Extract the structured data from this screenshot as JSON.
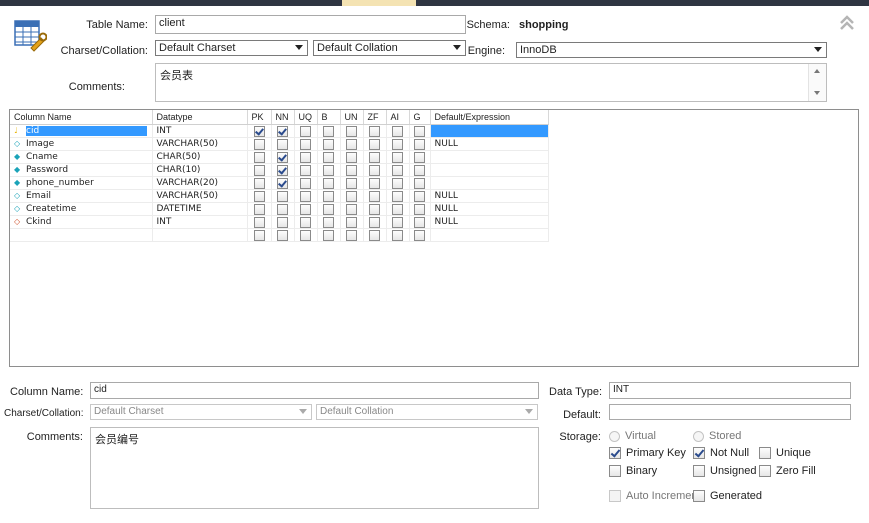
{
  "table": {
    "name_label": "Table Name:",
    "name_value": "client",
    "schema_label": "Schema:",
    "schema_value": "shopping",
    "charset_label": "Charset/Collation:",
    "charset_value": "Default Charset",
    "collation_value": "Default Collation",
    "engine_label": "Engine:",
    "engine_value": "InnoDB",
    "comments_label": "Comments:",
    "comments_value": "会员表"
  },
  "grid": {
    "headers": [
      "Column Name",
      "Datatype",
      "PK",
      "NN",
      "UQ",
      "B",
      "UN",
      "ZF",
      "AI",
      "G",
      "Default/Expression"
    ],
    "rows": [
      {
        "name": "cid",
        "type": "INT",
        "flags": [
          1,
          1,
          0,
          0,
          0,
          0,
          0,
          0
        ],
        "default": "",
        "icon": "key",
        "selected": true
      },
      {
        "name": "Image",
        "type": "VARCHAR(50)",
        "flags": [
          0,
          0,
          0,
          0,
          0,
          0,
          0,
          0
        ],
        "default": "NULL",
        "icon": "diamond-empty",
        "selected": false
      },
      {
        "name": "Cname",
        "type": "CHAR(50)",
        "flags": [
          0,
          1,
          0,
          0,
          0,
          0,
          0,
          0
        ],
        "default": "",
        "icon": "diamond-filled",
        "selected": false
      },
      {
        "name": "Password",
        "type": "CHAR(10)",
        "flags": [
          0,
          1,
          0,
          0,
          0,
          0,
          0,
          0
        ],
        "default": "",
        "icon": "diamond-filled",
        "selected": false
      },
      {
        "name": "phone_number",
        "type": "VARCHAR(20)",
        "flags": [
          0,
          1,
          0,
          0,
          0,
          0,
          0,
          0
        ],
        "default": "",
        "icon": "diamond-filled",
        "selected": false
      },
      {
        "name": "Email",
        "type": "VARCHAR(50)",
        "flags": [
          0,
          0,
          0,
          0,
          0,
          0,
          0,
          0
        ],
        "default": "NULL",
        "icon": "diamond-empty",
        "selected": false
      },
      {
        "name": "Createtime",
        "type": "DATETIME",
        "flags": [
          0,
          0,
          0,
          0,
          0,
          0,
          0,
          0
        ],
        "default": "NULL",
        "icon": "diamond-empty",
        "selected": false
      },
      {
        "name": "Ckind",
        "type": "INT",
        "flags": [
          0,
          0,
          0,
          0,
          0,
          0,
          0,
          0
        ],
        "default": "NULL",
        "icon": "diamond-red",
        "selected": false
      },
      {
        "name": "",
        "type": "",
        "flags": [
          0,
          0,
          0,
          0,
          0,
          0,
          0,
          0
        ],
        "default": "",
        "icon": "",
        "selected": false
      }
    ]
  },
  "details": {
    "column_name_label": "Column Name:",
    "column_name_value": "cid",
    "charset_label": "Charset/Collation:",
    "charset_value": "Default Charset",
    "collation_value": "Default Collation",
    "comments_label": "Comments:",
    "comments_value": "会员编号",
    "data_type_label": "Data Type:",
    "data_type_value": "INT",
    "default_label": "Default:",
    "default_value": "",
    "storage_label": "Storage:",
    "virtual_label": "Virtual",
    "stored_label": "Stored",
    "primary_key_label": "Primary Key",
    "not_null_label": "Not Null",
    "unique_label": "Unique",
    "binary_label": "Binary",
    "unsigned_label": "Unsigned",
    "zero_fill_label": "Zero Fill",
    "auto_increment_label": "Auto Increment",
    "generated_label": "Generated"
  },
  "colors": {
    "selection": "#3399ff",
    "check": "#2a4b8d",
    "key_icon": "#e8b400",
    "diamond_filled": "#1aa3b8",
    "diamond_red": "#d0502a"
  },
  "icons": {
    "table_editor": "table-wrench-icon",
    "collapse": "double-chevron-up-icon"
  }
}
